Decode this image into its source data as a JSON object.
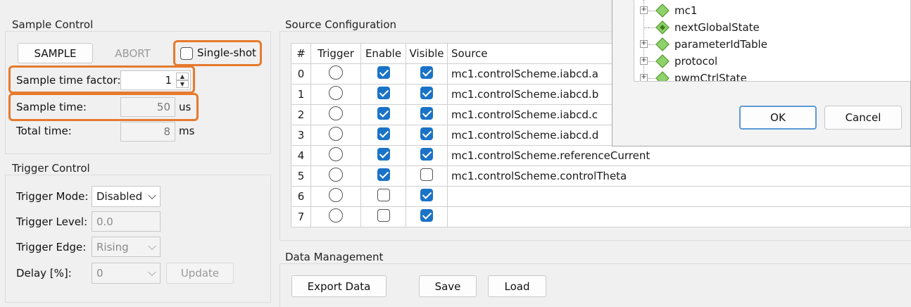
{
  "sample_control": {
    "title": "Sample Control",
    "sample_button": "SAMPLE",
    "abort_button": "ABORT",
    "single_shot_label": "Single-shot",
    "single_shot_checked": false,
    "sample_time_factor_label": "Sample time factor:",
    "sample_time_factor_value": "1",
    "sample_time_label": "Sample time:",
    "sample_time_value": "50",
    "sample_time_unit": "us",
    "total_time_label": "Total time:",
    "total_time_value": "8",
    "total_time_unit": "ms"
  },
  "trigger_control": {
    "title": "Trigger Control",
    "mode_label": "Trigger Mode:",
    "mode_value": "Disabled",
    "level_label": "Trigger Level:",
    "level_value": "0.0",
    "edge_label": "Trigger Edge:",
    "edge_value": "Rising",
    "delay_label": "Delay [%]:",
    "delay_value": "0",
    "update_button": "Update"
  },
  "source_configuration": {
    "title": "Source Configuration",
    "columns": [
      "#",
      "Trigger",
      "Enable",
      "Visible",
      "Source"
    ],
    "rows": [
      {
        "num": "0",
        "enable": true,
        "visible": true,
        "source": "mc1.controlScheme.iabcd.a"
      },
      {
        "num": "1",
        "enable": true,
        "visible": true,
        "source": "mc1.controlScheme.iabcd.b"
      },
      {
        "num": "2",
        "enable": true,
        "visible": true,
        "source": "mc1.controlScheme.iabcd.c"
      },
      {
        "num": "3",
        "enable": true,
        "visible": true,
        "source": "mc1.controlScheme.iabcd.d"
      },
      {
        "num": "4",
        "enable": true,
        "visible": true,
        "source": "mc1.controlScheme.referenceCurrent"
      },
      {
        "num": "5",
        "enable": true,
        "visible": false,
        "source": "mc1.controlScheme.controlTheta"
      },
      {
        "num": "6",
        "enable": false,
        "visible": true,
        "source": ""
      },
      {
        "num": "7",
        "enable": false,
        "visible": true,
        "source": ""
      }
    ]
  },
  "data_management": {
    "title": "Data Management",
    "export_button": "Export Data",
    "save_button": "Save",
    "load_button": "Load"
  },
  "dialog": {
    "tree_items": [
      {
        "label": "mc1",
        "expandable": true
      },
      {
        "label": "nextGlobalState",
        "expandable": false
      },
      {
        "label": "parameterIdTable",
        "expandable": true
      },
      {
        "label": "protocol",
        "expandable": true
      },
      {
        "label": "pwmCtrlState",
        "expandable": true
      }
    ],
    "ok_button": "OK",
    "cancel_button": "Cancel"
  },
  "colors": {
    "highlight": "#e67a2e",
    "checkbox_checked": "#1a73c7",
    "tree_diamond": "#8fd16a"
  }
}
